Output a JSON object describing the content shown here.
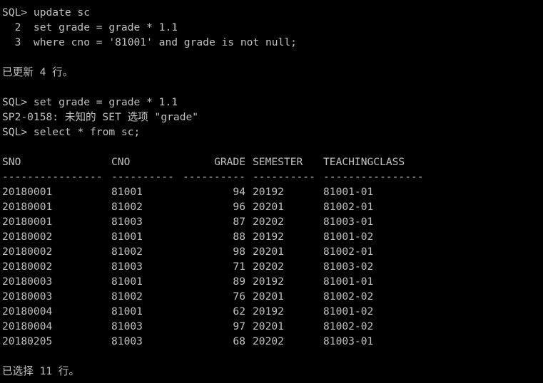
{
  "session": {
    "update_cmd": [
      "SQL> update sc",
      "  2  set grade = grade * 1.1",
      "  3  where cno = '81001' and grade is not null;"
    ],
    "update_result": "已更新 4 行。",
    "set_cmd": "SQL> set grade = grade * 1.1",
    "set_error": "SP2-0158: 未知的 SET 选项 \"grade\"",
    "select_cmd": "SQL> select * from sc;",
    "select_result": "已选择 11 行。"
  },
  "table": {
    "columns": [
      "SNO",
      "CNO",
      "GRADE",
      "SEMESTER",
      "TEACHINGCLASS"
    ],
    "separators": [
      "----------------",
      "----------",
      "----------",
      "----------",
      "----------------"
    ],
    "rows": [
      [
        "20180001",
        "81001",
        "94",
        "20192",
        "81001-01"
      ],
      [
        "20180001",
        "81002",
        "96",
        "20201",
        "81002-01"
      ],
      [
        "20180001",
        "81003",
        "87",
        "20202",
        "81003-01"
      ],
      [
        "20180002",
        "81001",
        "88",
        "20192",
        "81001-02"
      ],
      [
        "20180002",
        "81002",
        "98",
        "20201",
        "81002-01"
      ],
      [
        "20180002",
        "81003",
        "71",
        "20202",
        "81003-02"
      ],
      [
        "20180003",
        "81001",
        "89",
        "20192",
        "81001-01"
      ],
      [
        "20180003",
        "81002",
        "76",
        "20201",
        "81002-02"
      ],
      [
        "20180004",
        "81001",
        "62",
        "20192",
        "81001-02"
      ],
      [
        "20180004",
        "81003",
        "97",
        "20201",
        "81002-02"
      ],
      [
        "20180205",
        "81003",
        "68",
        "20202",
        "81003-01"
      ]
    ]
  },
  "colors": {
    "background": "#000000",
    "text": "#c0c0c0"
  }
}
